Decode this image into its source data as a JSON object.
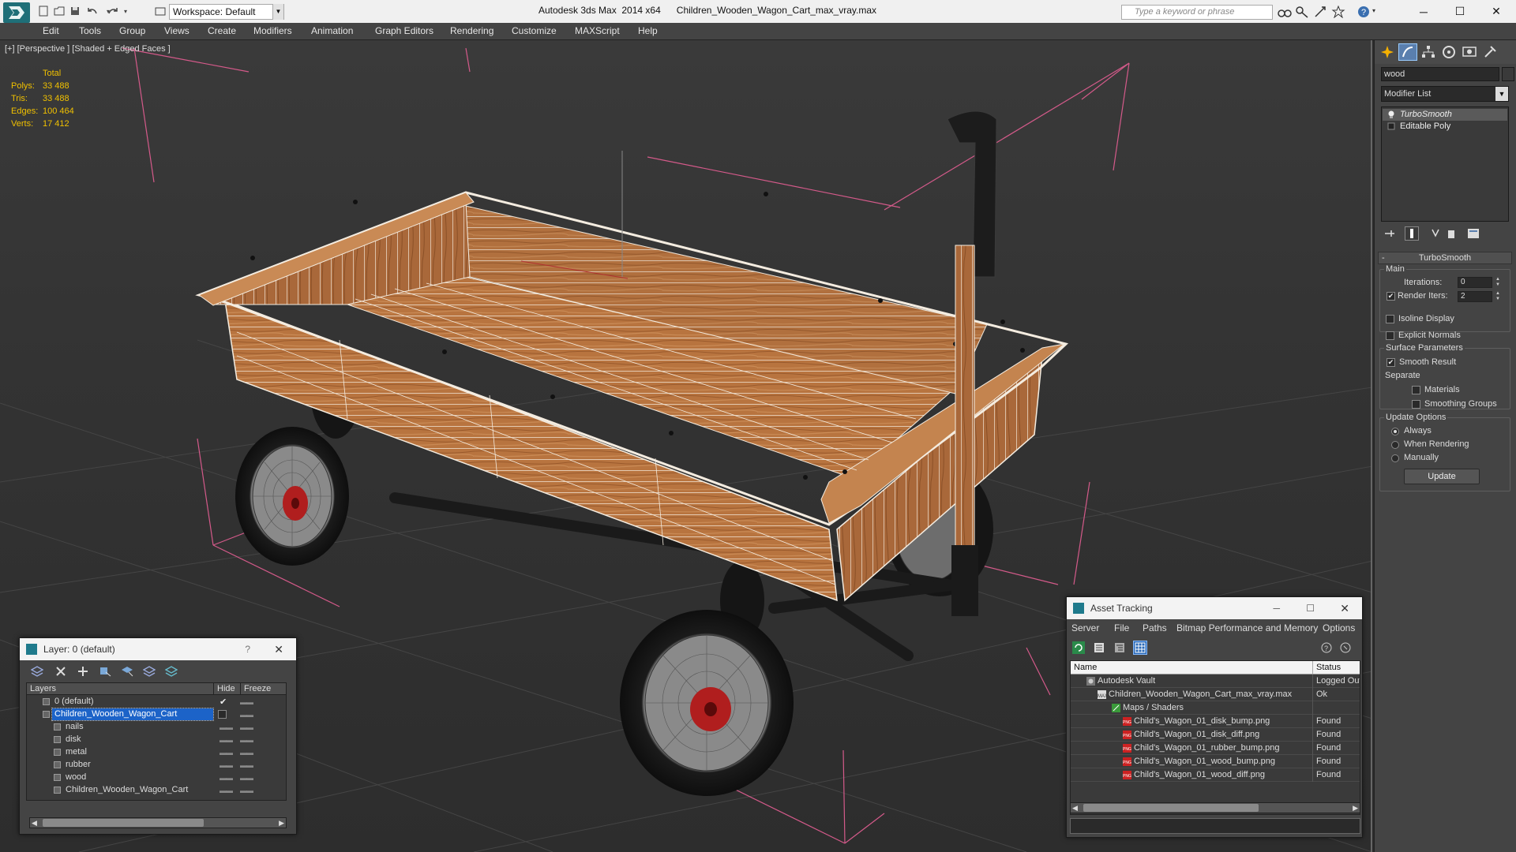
{
  "app": {
    "title_app": "Autodesk 3ds Max  2014 x64",
    "title_file": "Children_Wooden_Wagon_Cart_max_vray.max",
    "workspace": "Workspace: Default",
    "search_placeholder": "Type a keyword or phrase"
  },
  "menu": [
    "Edit",
    "Tools",
    "Group",
    "Views",
    "Create",
    "Modifiers",
    "Animation",
    "Graph Editors",
    "Rendering",
    "Customize",
    "MAXScript",
    "Help"
  ],
  "viewport": {
    "label": "[+] [Perspective ] [Shaded + Edged Faces ]",
    "stats_header": "Total",
    "stats": [
      {
        "key": "Polys:",
        "value": "33 488"
      },
      {
        "key": "Tris:",
        "value": "33 488"
      },
      {
        "key": "Edges:",
        "value": "100 464"
      },
      {
        "key": "Verts:",
        "value": "17 412"
      }
    ]
  },
  "command_panel": {
    "object_name": "wood",
    "modifier_list": "Modifier List",
    "stack": [
      "TurboSmooth",
      "Editable Poly"
    ],
    "rollout_title": "TurboSmooth",
    "main_label": "Main",
    "iterations_label": "Iterations:",
    "iterations_value": "0",
    "render_iters_label": "Render Iters:",
    "render_iters_value": "2",
    "isoline": "Isoline Display",
    "explicit_normals": "Explicit Normals",
    "surface_params": "Surface Parameters",
    "smooth_result": "Smooth Result",
    "separate": "Separate",
    "materials": "Materials",
    "smoothing_groups": "Smoothing Groups",
    "update_options": "Update Options",
    "always": "Always",
    "when_rendering": "When Rendering",
    "manually": "Manually",
    "update_button": "Update"
  },
  "layer_dialog": {
    "title": "Layer: 0 (default)",
    "help": "?",
    "columns": {
      "layers": "Layers",
      "hide": "Hide",
      "freeze": "Freeze"
    },
    "rows": [
      {
        "name": "0 (default)",
        "indent": 0
      },
      {
        "name": "Children_Wooden_Wagon_Cart",
        "indent": 0
      },
      {
        "name": "nails",
        "indent": 1
      },
      {
        "name": "disk",
        "indent": 1
      },
      {
        "name": "metal",
        "indent": 1
      },
      {
        "name": "rubber",
        "indent": 1
      },
      {
        "name": "wood",
        "indent": 1
      },
      {
        "name": "Children_Wooden_Wagon_Cart",
        "indent": 1
      }
    ]
  },
  "asset_tracking": {
    "title": "Asset Tracking",
    "menu": [
      "Server",
      "File",
      "Paths",
      "Bitmap Performance and Memory",
      "Options"
    ],
    "columns": {
      "name": "Name",
      "status": "Status"
    },
    "rows": [
      {
        "name": "Autodesk Vault",
        "status": "Logged Out",
        "level": 0
      },
      {
        "name": "Children_Wooden_Wagon_Cart_max_vray.max",
        "status": "Ok",
        "level": 1
      },
      {
        "name": "Maps / Shaders",
        "status": "",
        "level": 2
      },
      {
        "name": "Child's_Wagon_01_disk_bump.png",
        "status": "Found",
        "level": 3
      },
      {
        "name": "Child's_Wagon_01_disk_diff.png",
        "status": "Found",
        "level": 3
      },
      {
        "name": "Child's_Wagon_01_rubber_bump.png",
        "status": "Found",
        "level": 3
      },
      {
        "name": "Child's_Wagon_01_wood_bump.png",
        "status": "Found",
        "level": 3
      },
      {
        "name": "Child's_Wagon_01_wood_diff.png",
        "status": "Found",
        "level": 3
      }
    ]
  },
  "colors": {
    "accent": "#1c63c8",
    "stats": "#f0c000",
    "wood": "#b06a3a",
    "hub": "#b01e1e"
  }
}
